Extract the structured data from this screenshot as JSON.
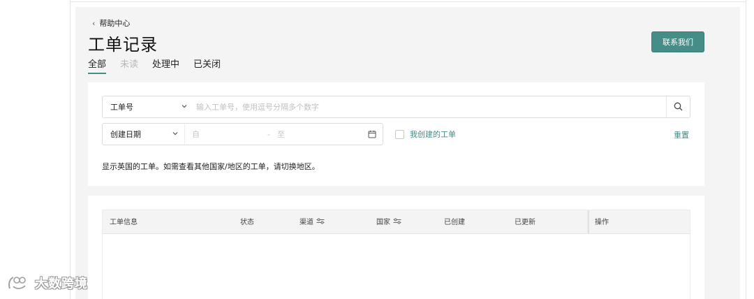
{
  "header": {
    "back_label": "帮助中心",
    "title": "工单记录",
    "contact_label": "联系我们"
  },
  "tabs": [
    {
      "label": "全部",
      "active": true
    },
    {
      "label": "未读",
      "active": false
    },
    {
      "label": "处理中",
      "active": false
    },
    {
      "label": "已关闭",
      "active": false
    }
  ],
  "filters": {
    "ticket_select": "工单号",
    "search_placeholder": "输入工单号，使用逗号分隔多个数字",
    "date_select": "创建日期",
    "date_from_placeholder": "自",
    "date_separator": "-",
    "date_to_placeholder": "至",
    "mine_label": "我创建的工单",
    "mine_checked": false,
    "reset_label": "重置",
    "notice": "显示英国的工单。如需查看其他国家/地区的工单，请切换地区。"
  },
  "table": {
    "columns": [
      "工单信息",
      "状态",
      "渠道",
      "国家",
      "已创建",
      "已更新",
      "操作"
    ]
  },
  "watermark": {
    "text": "大数跨境"
  },
  "colors": {
    "accent": "#468c87",
    "background": "#f4f4f4"
  },
  "icons": {
    "back": "chevron-left-icon",
    "search": "search-icon",
    "calendar": "calendar-icon",
    "filter": "filter-sliders-icon"
  }
}
